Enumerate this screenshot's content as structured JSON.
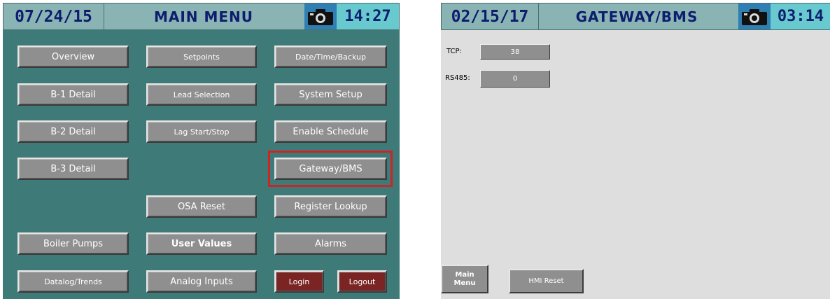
{
  "colors": {
    "titlebar": "#8ab4b4",
    "title_text": "#0e1d6e",
    "menu_bg": "#3e7a78",
    "button": "#8f8f8f",
    "login_button": "#7a2424",
    "highlight": "#cc2525",
    "gateway_bg": "#dedede",
    "camera_cell": "#2f7fb3",
    "time_cell": "#68c9cf"
  },
  "main_menu": {
    "date": "07/24/15",
    "title": "MAIN MENU",
    "time": "14:27",
    "camera_icon": "camera-icon",
    "buttons": {
      "overview": "Overview",
      "setpoints": "Setpoints",
      "date_time_backup": "Date/Time/Backup",
      "b1_detail": "B-1 Detail",
      "lead_selection": "Lead Selection",
      "system_setup": "System Setup",
      "b2_detail": "B-2 Detail",
      "lag_start_stop": "Lag Start/Stop",
      "enable_schedule": "Enable Schedule",
      "b3_detail": "B-3 Detail",
      "gateway_bms": "Gateway/BMS",
      "osa_reset": "OSA Reset",
      "register_lookup": "Register Lookup",
      "boiler_pumps": "Boiler Pumps",
      "user_values": "User Values",
      "alarms": "Alarms",
      "datalog_trends": "Datalog/Trends",
      "analog_inputs": "Analog Inputs",
      "login": "Login",
      "logout": "Logout"
    }
  },
  "gateway": {
    "date": "02/15/17",
    "title": "GATEWAY/BMS",
    "time": "03:14",
    "camera_icon": "camera-icon",
    "tcp_label": "TCP:",
    "tcp_value": "38",
    "rs485_label": "RS485:",
    "rs485_value": "0",
    "main_menu_line1": "Main",
    "main_menu_line2": "Menu",
    "hmi_reset": "HMI Reset"
  }
}
